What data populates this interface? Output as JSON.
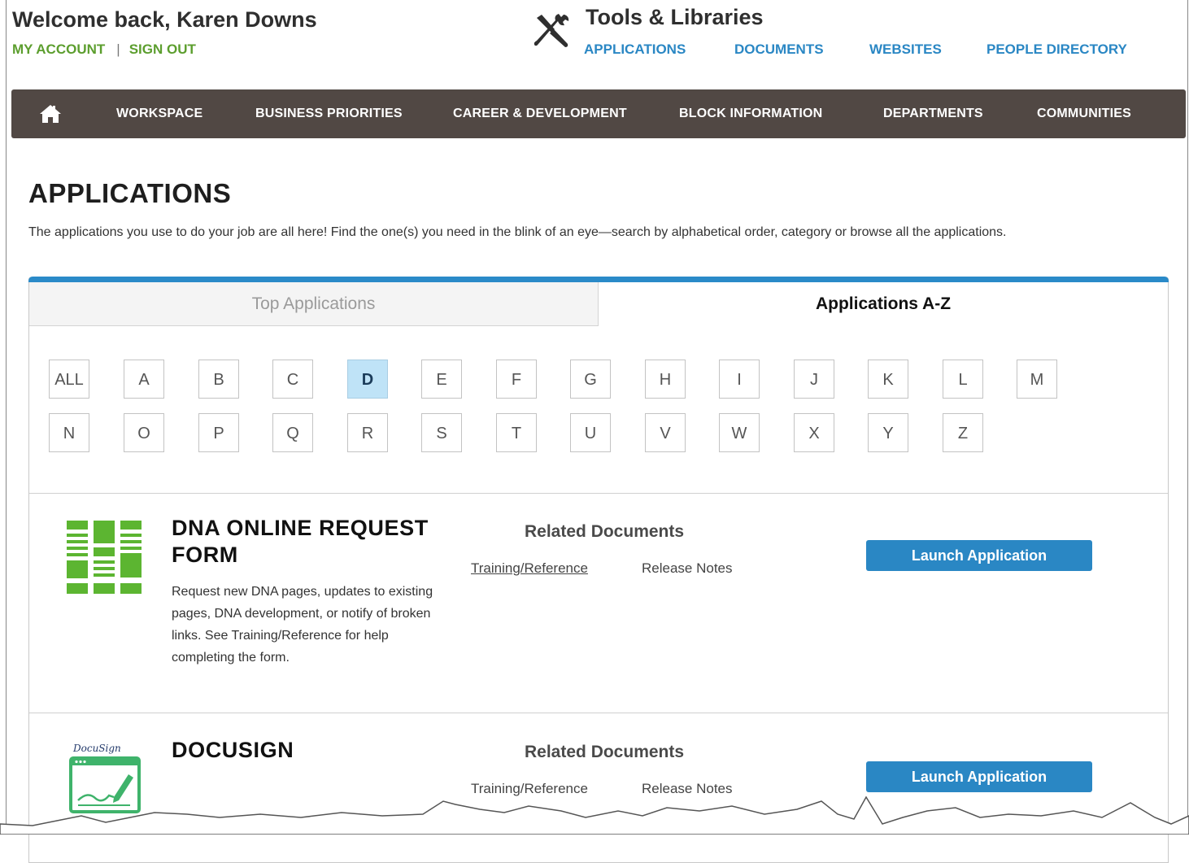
{
  "header": {
    "welcome": "Welcome back, Karen Downs",
    "my_account": "MY ACCOUNT",
    "separator": "|",
    "sign_out": "SIGN OUT",
    "tools_title": "Tools & Libraries",
    "tool_links": [
      "APPLICATIONS",
      "DOCUMENTS",
      "WEBSITES",
      "PEOPLE DIRECTORY"
    ]
  },
  "nav": {
    "items": [
      "WORKSPACE",
      "BUSINESS PRIORITIES",
      "CAREER & DEVELOPMENT",
      "BLOCK INFORMATION",
      "DEPARTMENTS",
      "COMMUNITIES"
    ]
  },
  "page": {
    "title": "APPLICATIONS",
    "intro": "The applications you use to do your job are all here! Find the one(s) you need in the blink of an eye—search by alphabetical order, category or browse all the applications."
  },
  "tabs": {
    "top": "Top Applications",
    "az": "Applications A-Z",
    "active": "Applications A-Z"
  },
  "letters": {
    "row1": [
      "ALL",
      "A",
      "B",
      "C",
      "D",
      "E",
      "F",
      "G",
      "H",
      "I",
      "J",
      "K",
      "L",
      "M"
    ],
    "row2": [
      "N",
      "O",
      "P",
      "Q",
      "R",
      "S",
      "T",
      "U",
      "V",
      "W",
      "X",
      "Y",
      "Z"
    ],
    "selected": "D"
  },
  "apps": [
    {
      "title_line1": "DNA ONLINE REQUEST",
      "title_line2": "FORM",
      "description": "Request new DNA pages, updates to existing pages, DNA development, or notify of broken links. See Training/Reference for help completing the form.",
      "related_title": "Related Documents",
      "docs": [
        "Training/Reference",
        "Release Notes"
      ],
      "launch": "Launch Application"
    },
    {
      "title_line1": "DOCUSIGN",
      "logo_text": "DocuSign",
      "related_title": "Related Documents",
      "docs": [
        "Training/Reference",
        "Release Notes"
      ],
      "launch": "Launch Application"
    }
  ],
  "colors": {
    "accent_green": "#5c9e2e",
    "link_blue": "#2a87c4",
    "nav_bg": "#514844",
    "selected_letter": "#bfe3f7",
    "app_icon_green": "#5cb531",
    "docusign_green": "#3fb36b"
  }
}
